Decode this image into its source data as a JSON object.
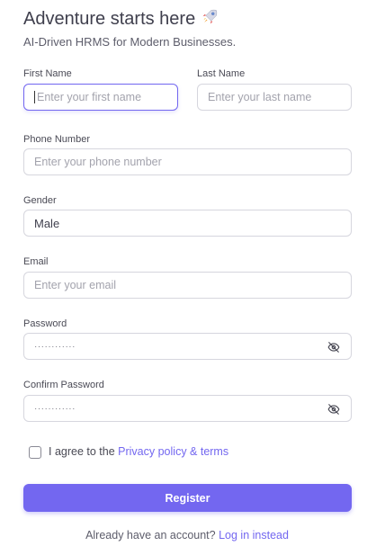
{
  "header": {
    "title": "Adventure starts here",
    "title_icon": "rocket-icon",
    "subtitle": "AI-Driven HRMS for Modern Businesses."
  },
  "form": {
    "first_name": {
      "label": "First Name",
      "placeholder": "Enter your first name",
      "focused": true
    },
    "last_name": {
      "label": "Last Name",
      "placeholder": "Enter your last name"
    },
    "phone": {
      "label": "Phone Number",
      "placeholder": "Enter your phone number"
    },
    "gender": {
      "label": "Gender",
      "value": "Male"
    },
    "email": {
      "label": "Email",
      "placeholder": "Enter your email"
    },
    "password": {
      "label": "Password",
      "masked_value": "············",
      "toggle_icon": "eye-off-icon"
    },
    "confirm_password": {
      "label": "Confirm Password",
      "masked_value": "············",
      "toggle_icon": "eye-off-icon"
    },
    "agree": {
      "prefix": "I agree to the",
      "link_text": "Privacy policy & terms",
      "checked": false
    },
    "register_label": "Register"
  },
  "footer": {
    "prefix": "Already have an account?",
    "link_text": "Log in instead"
  },
  "colors": {
    "primary": "#7367f0",
    "text": "#4b4b5a",
    "border": "#d6d6de",
    "placeholder": "#a3a3ad"
  }
}
